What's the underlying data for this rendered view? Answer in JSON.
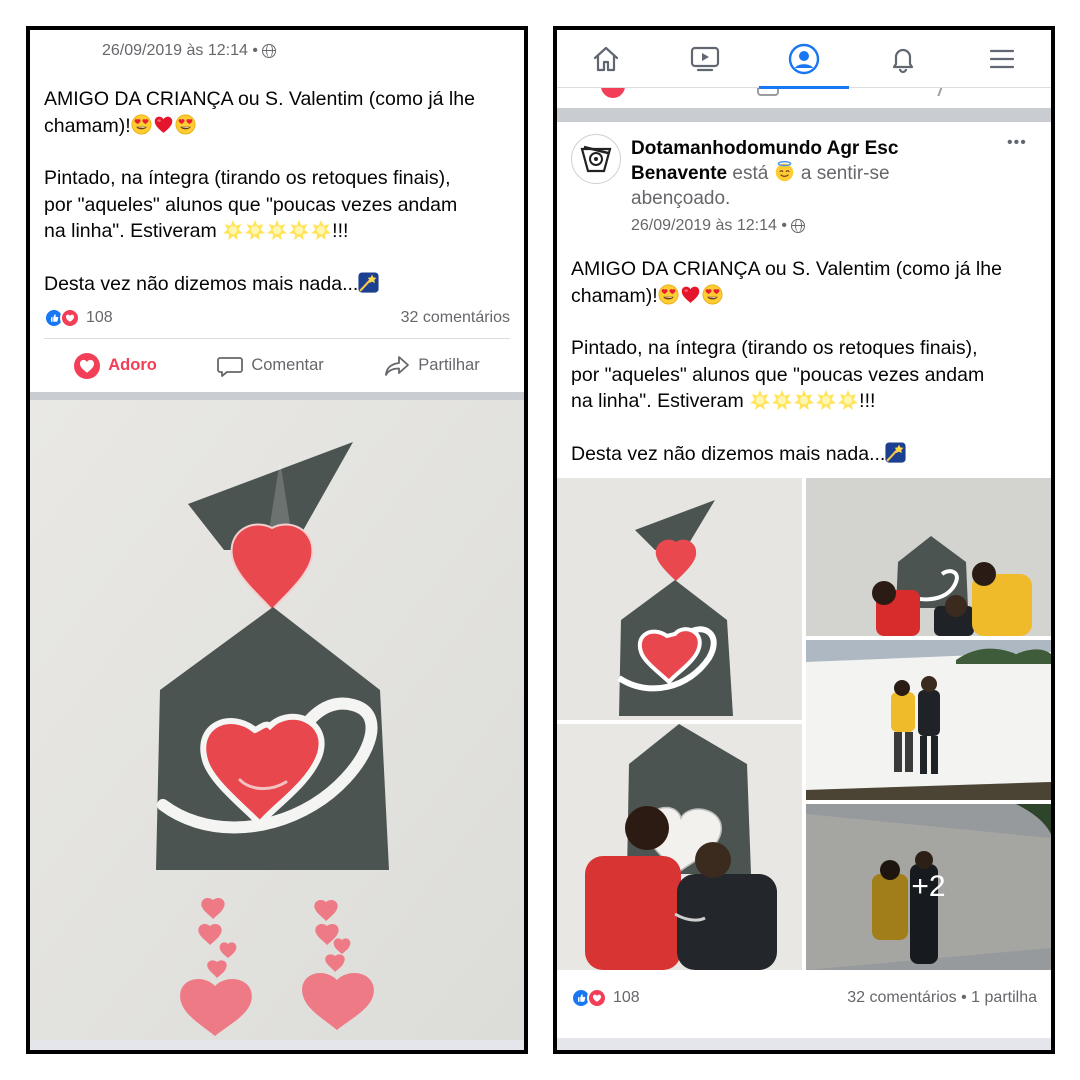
{
  "post": {
    "author_line1": "Dotamanhodomundo Agr Esc",
    "author_line2": "Benavente",
    "feeling_prefix": "está",
    "feeling_text": "a sentir-se",
    "feeling_text2": "abençoado.",
    "timestamp": "26/09/2019 às 12:14 •",
    "text_line1": "AMIGO DA CRIANÇA ou S. Valentim (como já lhe",
    "text_line2": "chamam)!",
    "text_p2_line1": "Pintado, na íntegra (tirando os retoques finais),",
    "text_p2_line2": "por \"aqueles\" alunos que \"poucas vezes andam",
    "text_p2_line3": "na linha\". Estiveram",
    "text_p2_end": "!!!",
    "text_p3": "Desta vez não dizemos mais nada...",
    "reaction_count": "108",
    "comment_count": "32 comentários",
    "share_count": "• 1 partilha",
    "more_photos": "+2",
    "more_options": "•••"
  },
  "actions": {
    "love_label": "Adoro",
    "comment_label": "Comentar",
    "share_label": "Partilhar"
  },
  "icons": {
    "nav": [
      "home-icon",
      "watch-icon",
      "profile-icon",
      "notifications-icon",
      "menu-icon"
    ],
    "reactions": [
      "like-icon",
      "love-icon"
    ],
    "emoji": [
      "heart-eyes-emoji",
      "red-heart-emoji",
      "glowing-star-emoji",
      "shooting-star-emoji",
      "smiling-halo-emoji"
    ]
  },
  "colors": {
    "facebook_blue": "#1877f2",
    "love_red": "#f33e58",
    "secondary_text": "#65676b",
    "mural_gray": "#4b5451",
    "mural_heart": "#e8484e"
  }
}
